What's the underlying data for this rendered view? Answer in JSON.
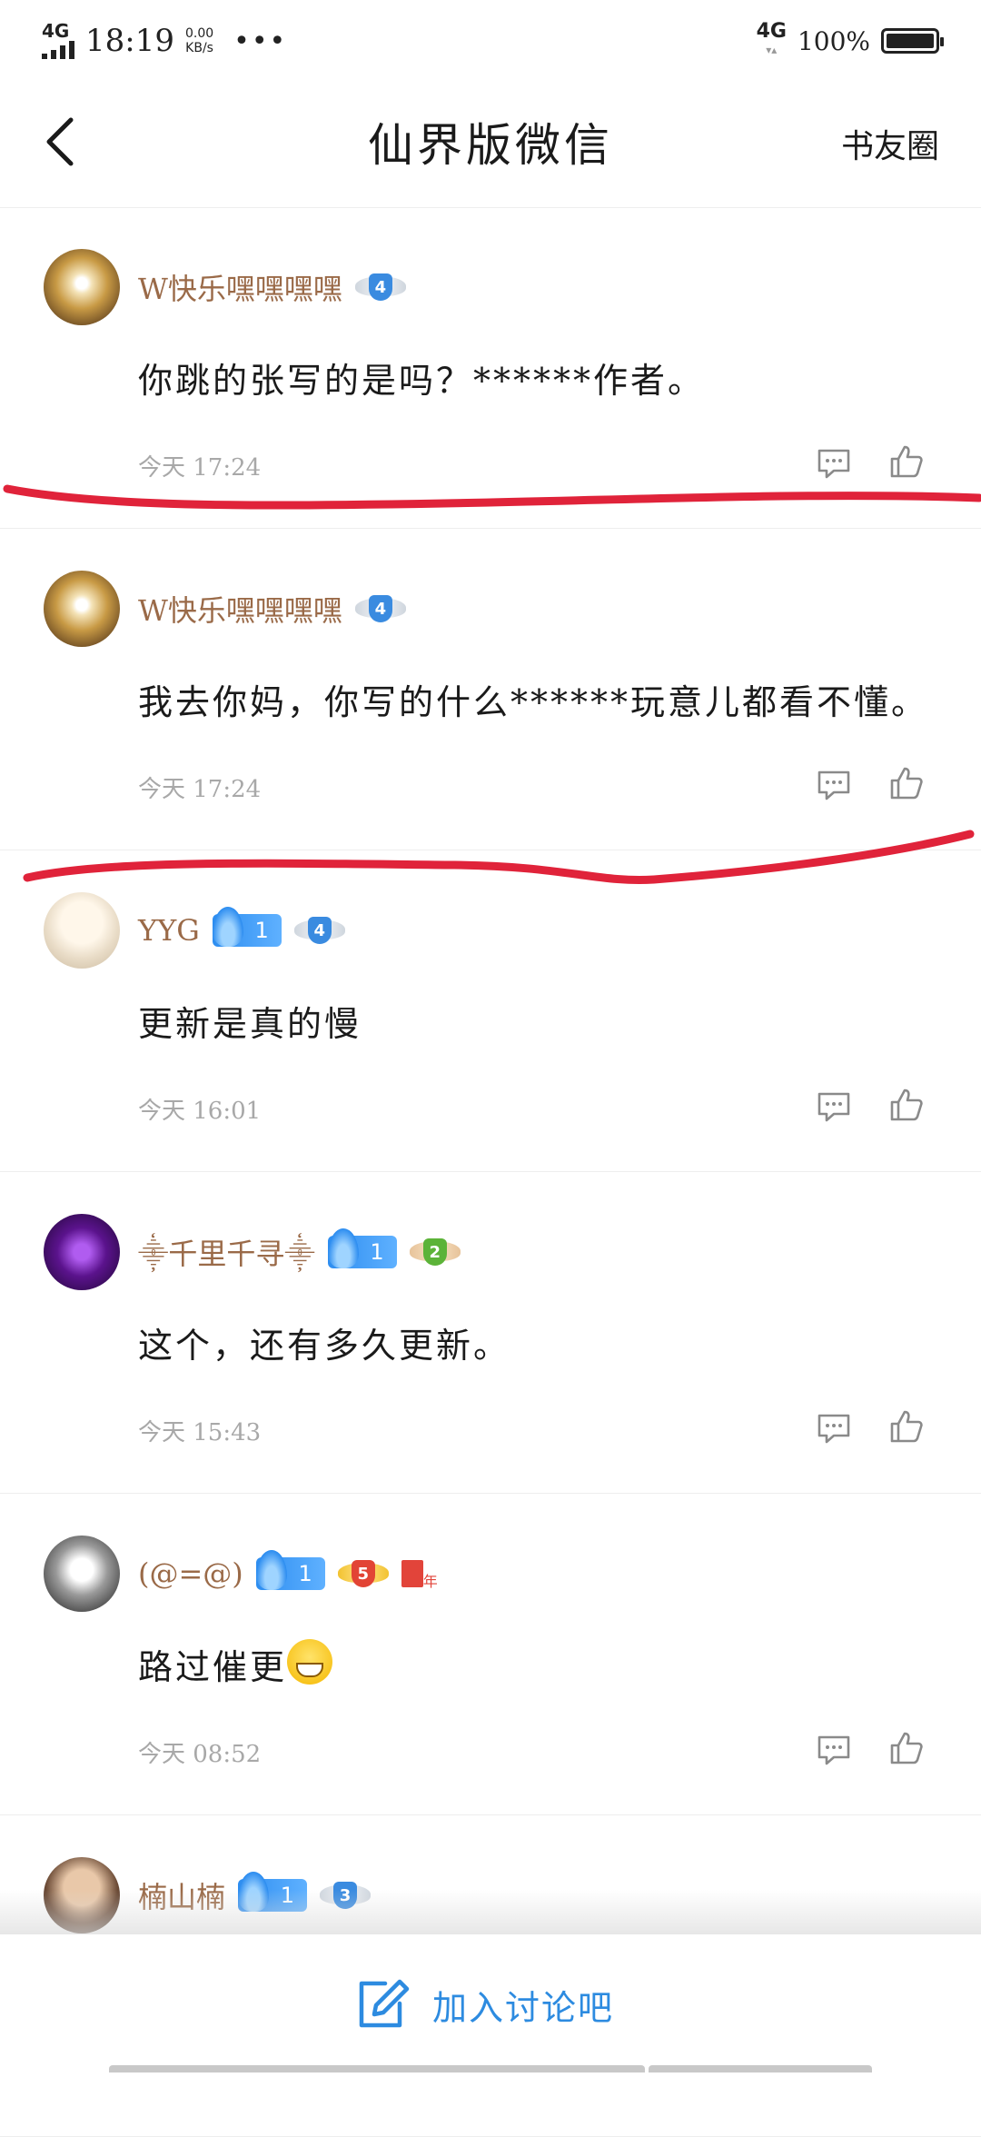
{
  "status_bar": {
    "network_left": "4G",
    "time": "18:19",
    "speed_value": "0.00",
    "speed_unit": "KB/s",
    "more": "•••",
    "network_right": "4G",
    "battery_percent": "100%"
  },
  "header": {
    "title": "仙界版微信",
    "right_link": "书友圈"
  },
  "comments": [
    {
      "username": "W快乐嘿嘿嘿嘿",
      "level": "4",
      "text": "你跳的张写的是吗？******作者。",
      "time": "今天 17:24"
    },
    {
      "username": "W快乐嘿嘿嘿嘿",
      "level": "4",
      "text": "我去你妈，你写的什么******玩意儿都看不懂。",
      "time": "今天 17:24"
    },
    {
      "username": "YYG",
      "fan_level": "1",
      "level": "4",
      "text": "更新是真的慢",
      "time": "今天 16:01"
    },
    {
      "username": "⸎千里千寻⸎",
      "fan_level": "1",
      "level": "2",
      "text": "这个，还有多久更新。",
      "time": "今天 15:43"
    },
    {
      "username": "(@=@)",
      "fan_level": "1",
      "level": "5",
      "year_badge": "年",
      "text": "路过催更",
      "time": "今天 08:52"
    },
    {
      "username": "楠山楠",
      "fan_level": "1",
      "level": "3"
    }
  ],
  "bottom": {
    "join_label": "加入讨论吧"
  },
  "colors": {
    "username": "#9a6a48",
    "accent_blue": "#2d8be0",
    "annotation_red": "#e0233a",
    "meta_gray": "#a8a8a8"
  }
}
